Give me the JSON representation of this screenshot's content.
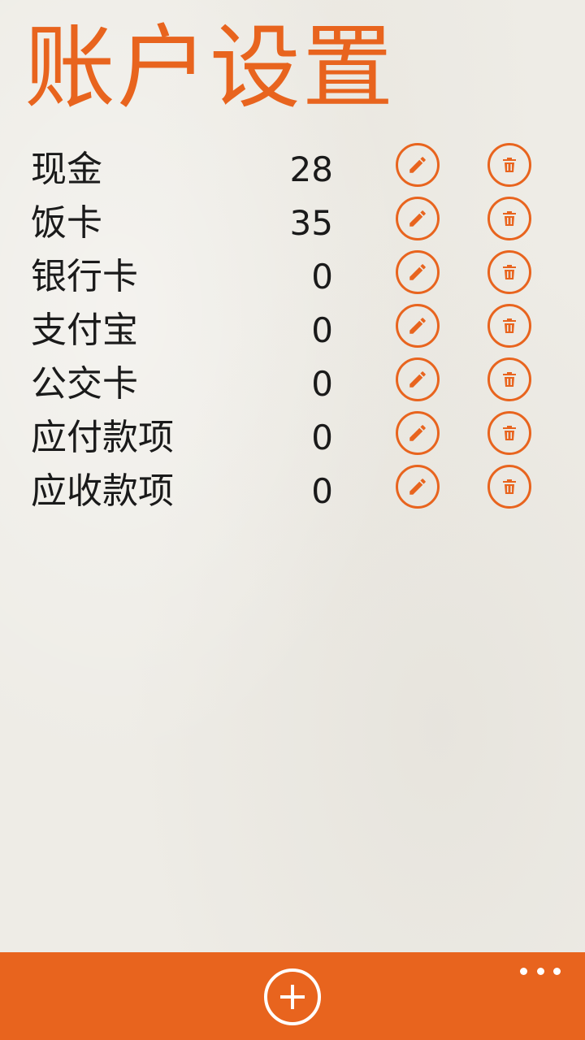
{
  "page": {
    "title": "账户设置"
  },
  "accounts": [
    {
      "name": "现金",
      "balance": "28"
    },
    {
      "name": "饭卡",
      "balance": "35"
    },
    {
      "name": "银行卡",
      "balance": "0"
    },
    {
      "name": "支付宝",
      "balance": "0"
    },
    {
      "name": "公交卡",
      "balance": "0"
    },
    {
      "name": "应付款项",
      "balance": "0"
    },
    {
      "name": "应收款项",
      "balance": "0"
    }
  ],
  "icons": {
    "edit": "pencil-icon",
    "delete": "trash-icon",
    "add": "plus-icon",
    "more": "more-dots-icon"
  },
  "colors": {
    "accent": "#e8641e",
    "background": "#eeece6",
    "text": "#1a1a1a",
    "app_bar_foreground": "#ffffff"
  }
}
